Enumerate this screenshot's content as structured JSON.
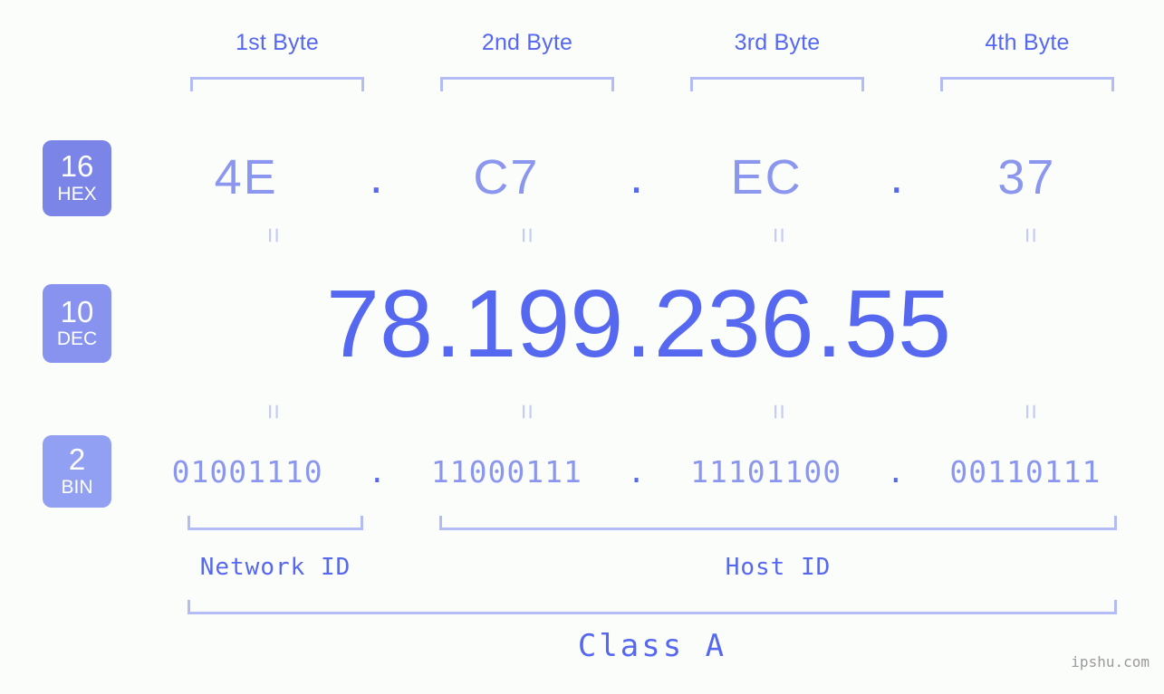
{
  "meta": {
    "background": "#fbfdfa",
    "accent_strong": "#5668ef",
    "accent_light": "#8b97ee",
    "bracket_color": "#b3bcf5",
    "watermark": "ipshu.com"
  },
  "byte_headers": [
    {
      "label": "1st Byte"
    },
    {
      "label": "2nd Byte"
    },
    {
      "label": "3rd Byte"
    },
    {
      "label": "4th Byte"
    }
  ],
  "bases": {
    "hex": {
      "number": "16",
      "abbr": "HEX",
      "color": "#7b85e8"
    },
    "dec": {
      "number": "10",
      "abbr": "DEC",
      "color": "#8793ef"
    },
    "bin": {
      "number": "2",
      "abbr": "BIN",
      "color": "#92a0f3"
    }
  },
  "separator": ".",
  "rows": {
    "hex": {
      "octets": [
        "4E",
        "C7",
        "EC",
        "37"
      ]
    },
    "dec": {
      "octets": [
        "78",
        "199",
        "236",
        "55"
      ]
    },
    "bin": {
      "octets": [
        "01001110",
        "11000111",
        "11101100",
        "00110111"
      ]
    }
  },
  "equals_symbol": "=",
  "segments": {
    "network_id": "Network ID",
    "host_id": "Host ID",
    "class": "Class A"
  }
}
